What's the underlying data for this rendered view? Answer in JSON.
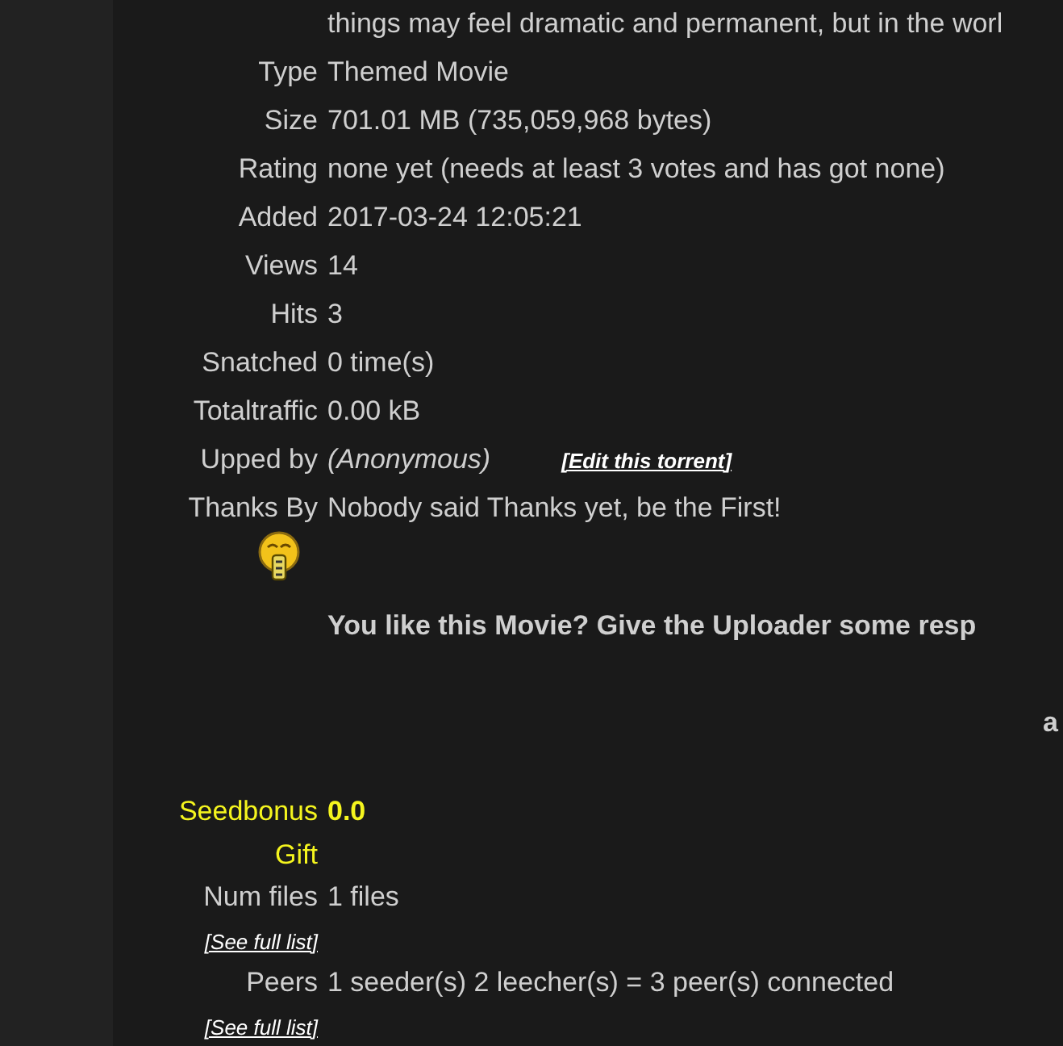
{
  "description_tail": "things may feel dramatic and permanent, but in the worl",
  "details": [
    {
      "label": "Type",
      "value": "Themed Movie"
    },
    {
      "label": "Size",
      "value": "701.01 MB (735,059,968 bytes)"
    },
    {
      "label": "Rating",
      "value": "none yet (needs at least 3 votes and has got none)"
    },
    {
      "label": "Added",
      "value": "2017-03-24 12:05:21"
    },
    {
      "label": "Views",
      "value": "14"
    },
    {
      "label": "Hits",
      "value": "3"
    },
    {
      "label": "Snatched",
      "value": "0 time(s)"
    },
    {
      "label": "Totaltraffic",
      "value": "0.00 kB"
    }
  ],
  "uploader": {
    "label": "Upped by",
    "value": "(Anonymous)",
    "edit_link": "[Edit this torrent]"
  },
  "thanks": {
    "label": "Thanks By",
    "value": "Nobody said Thanks yet, be the First!",
    "prompt": "You like this Movie? Give the Uploader some resp"
  },
  "cut_text": "a",
  "seedbonus": {
    "label": "Seedbonus",
    "value": "0.0",
    "gift_label": "Gift"
  },
  "lists": [
    {
      "label": "Num files",
      "value": "1 files",
      "link": "[See full list]"
    },
    {
      "label": "Peers",
      "value": "1 seeder(s) 2 leecher(s) = 3 peer(s) connected",
      "link": "[See full list]"
    }
  ]
}
